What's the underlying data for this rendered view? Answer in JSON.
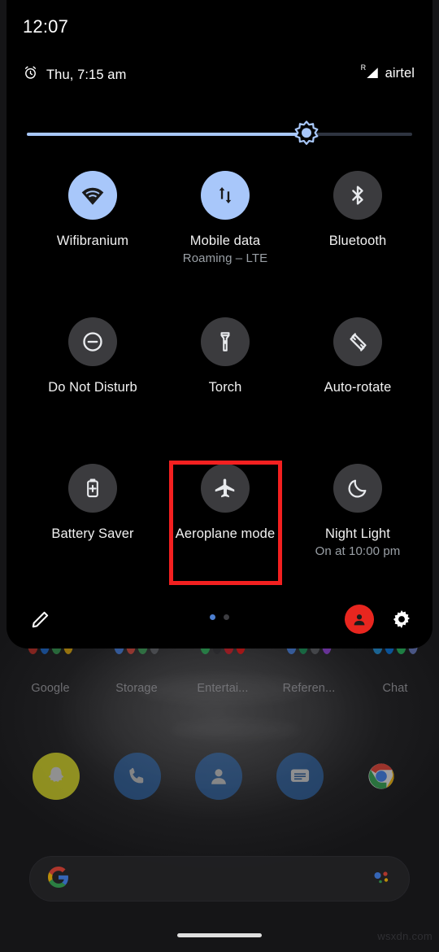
{
  "statusbar": {
    "clock": "12:07"
  },
  "qs_header": {
    "alarm_icon": "alarm-clock-icon",
    "alarm_text": "Thu, 7:15 am",
    "roaming_indicator": "R",
    "signal_icon": "signal-bars-icon",
    "carrier": "airtel"
  },
  "brightness": {
    "name": "brightness-slider",
    "value_percent": 71,
    "thumb_icon": "brightness-sun-icon"
  },
  "tiles": [
    [
      {
        "id": "wifi",
        "label": "Wifibranium",
        "sub": "",
        "icon": "wifi-icon",
        "state": "on"
      },
      {
        "id": "mobile-data",
        "label": "Mobile data",
        "sub": "Roaming – LTE",
        "icon": "mobile-data-icon",
        "state": "on"
      },
      {
        "id": "bluetooth",
        "label": "Bluetooth",
        "sub": "",
        "icon": "bluetooth-icon",
        "state": "off"
      }
    ],
    [
      {
        "id": "do-not-disturb",
        "label": "Do Not Disturb",
        "sub": "",
        "icon": "do-not-disturb-icon",
        "state": "off"
      },
      {
        "id": "torch",
        "label": "Torch",
        "sub": "",
        "icon": "flashlight-icon",
        "state": "off"
      },
      {
        "id": "auto-rotate",
        "label": "Auto-rotate",
        "sub": "",
        "icon": "auto-rotate-icon",
        "state": "off"
      }
    ],
    [
      {
        "id": "battery-saver",
        "label": "Battery Saver",
        "sub": "",
        "icon": "battery-plus-icon",
        "state": "off"
      },
      {
        "id": "aeroplane-mode",
        "label": "Aeroplane mode",
        "sub": "",
        "icon": "airplane-icon",
        "state": "off"
      },
      {
        "id": "night-light",
        "label": "Night Light",
        "sub": "On at 10:00 pm",
        "icon": "moon-icon",
        "state": "off"
      }
    ]
  ],
  "annotation": {
    "name": "aeroplane-mode-highlight",
    "color": "#f32020",
    "target": "Aeroplane mode"
  },
  "qs_footer": {
    "edit_icon": "pencil-edit-icon",
    "pages": [
      {
        "active": true
      },
      {
        "active": false
      }
    ],
    "user_icon": "user-avatar-icon",
    "settings_icon": "gear-icon"
  },
  "home": {
    "folders": [
      {
        "label": "Google",
        "colors": [
          "#d93025",
          "#1a73e8",
          "#34a853",
          "#fbbc04"
        ]
      },
      {
        "label": "Storage",
        "colors": [
          "#4285f4",
          "#ea4335",
          "#34a853",
          "#5f6368"
        ]
      },
      {
        "label": "Entertai...",
        "colors": [
          "#1db954",
          "#202124",
          "#e50914",
          "#ff0000"
        ]
      },
      {
        "label": "Referen...",
        "colors": [
          "#4285f4",
          "#0f9d58",
          "#5f6368",
          "#a142f4"
        ]
      },
      {
        "label": "Chat",
        "colors": [
          "#1da1f2",
          "#0084ff",
          "#25d366",
          "#7289da"
        ]
      }
    ],
    "dock": [
      {
        "name": "snapchat",
        "bg": "#d8d825",
        "glyph": "ghost"
      },
      {
        "name": "phone",
        "bg": "#2a5b96",
        "glyph": "phone"
      },
      {
        "name": "contacts",
        "bg": "#2a5b96",
        "glyph": "person"
      },
      {
        "name": "messages",
        "bg": "#2a5b96",
        "glyph": "message"
      },
      {
        "name": "chrome",
        "bg": "#555",
        "glyph": "chrome"
      }
    ],
    "search": {
      "logo_icon": "google-g-icon",
      "assistant_icon": "google-assistant-icon",
      "placeholder": ""
    },
    "gesture_bar": "home-gesture-bar",
    "watermark": "wsxdn.com"
  }
}
